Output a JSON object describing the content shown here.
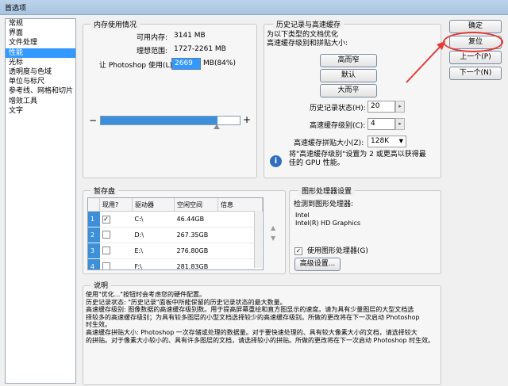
{
  "window": {
    "title": "首选项"
  },
  "sidebar": {
    "items": [
      {
        "label": "常规"
      },
      {
        "label": "界面"
      },
      {
        "label": "文件处理"
      },
      {
        "label": "性能"
      },
      {
        "label": "光标"
      },
      {
        "label": "透明度与色域"
      },
      {
        "label": "单位与标尺"
      },
      {
        "label": "参考线、网格和切片"
      },
      {
        "label": "增效工具"
      },
      {
        "label": "文字"
      }
    ],
    "selected_index": 3
  },
  "memory": {
    "title": "内存使用情况",
    "available_label": "可用内存:",
    "available_value": "3141 MB",
    "ideal_label": "理想范围:",
    "ideal_value": "1727-2261 MB",
    "photoshop_label": "让 Photoshop 使用(L):",
    "photoshop_value": "2669",
    "photoshop_percent": "MB(84%)",
    "slider_level_percent": 84,
    "minus": "−",
    "plus": "+"
  },
  "history": {
    "title": "历史记录与高速缓存",
    "desc": "为以下类型的文档优化\n高速缓存级别和拼贴大小:",
    "btn_tall": "高而窄",
    "btn_default": "默认",
    "btn_big": "大而平",
    "states_label": "历史记录状态(H):",
    "states_value": "20",
    "cache_label": "高速缓存级别(C):",
    "cache_value": "4",
    "tile_label": "高速缓存拼贴大小(Z):",
    "tile_value": "128K",
    "info": "将\"高速缓存级别\"设置为 2 或更高以获得最佳的 GPU 性能。"
  },
  "actions": {
    "ok": "确定",
    "reset": "复位",
    "prev": "上一个(P)",
    "next": "下一个(N)"
  },
  "scratch": {
    "title": "暂存盘",
    "headers": {
      "active": "现用?",
      "drive": "驱动器",
      "free": "空闲空间",
      "info": "信息"
    },
    "rows": [
      {
        "idx": "1",
        "checked": "✓",
        "drive": "C:\\",
        "free": "46.44GB"
      },
      {
        "idx": "2",
        "checked": "",
        "drive": "D:\\",
        "free": "267.35GB"
      },
      {
        "idx": "3",
        "checked": "",
        "drive": "E:\\",
        "free": "276.80GB"
      },
      {
        "idx": "4",
        "checked": "",
        "drive": "F:\\",
        "free": "281.83GB"
      }
    ]
  },
  "gpu": {
    "title": "图形处理器设置",
    "detected_label": "检测到图形处理器:",
    "vendor": "Intel",
    "model": "Intel(R) HD Graphics",
    "use_label": "使用图形处理器(G)",
    "use_checked": "✓",
    "advanced": "高级设置..."
  },
  "description": {
    "title": "说明",
    "lines": [
      "使用\"优化...\"按钮时会考虑您的硬件配置。",
      "历史记录状态: \"历史记录\"面板中所能保留的历史记录状态的最大数量。",
      "高速缓存级别: 图像数据的高速缓存级别数。用于提高屏幕重绘和直方图显示的速度。请为具有少量图层的大型文档选",
      "择较多的高速缓存级别；为具有较多图层的小型文档选择较少的高速缓存级别。所做的更改将在下一次启动 Photoshop",
      "时生效。",
      "高速缓存拼贴大小: Photoshop 一次存储或处理的数据量。对于要快速处理的、具有较大像素大小的文档，请选择较大",
      "的拼贴。对于像素大小较小的、具有许多图层的文档，请选择较小的拼贴。所做的更改将在下一次启动 Photoshop 时生效。"
    ]
  },
  "colors": {
    "selection": "#3399ff",
    "slider_fill": "#3c8fd8",
    "annotation": "#e53935"
  }
}
